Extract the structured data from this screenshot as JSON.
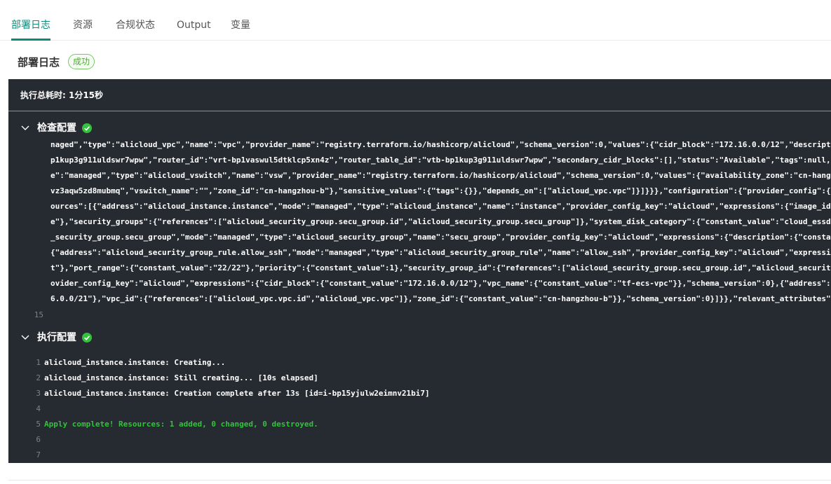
{
  "tabs": [
    {
      "label": "部署日志",
      "active": true
    },
    {
      "label": "资源"
    },
    {
      "label": "合规状态"
    },
    {
      "label": "Output"
    },
    {
      "label": "变量"
    }
  ],
  "header": {
    "title": "部署日志",
    "status": "成功"
  },
  "log": {
    "duration": "执行总耗时: 1分15秒",
    "groups": [
      {
        "title": "检查配置",
        "status_icon": "check-circle-icon",
        "lines": [
          "naged\",\"type\":\"alicloud_vpc\",\"name\":\"vpc\",\"provider_name\":\"registry.terraform.io/hashicorp/alicloud\",\"schema_version\":0,\"values\":{\"cidr_block\":\"172.16.0.0/12\",\"descripti",
          "p1kup3g911uldswr7wpw\",\"router_id\":\"vrt-bp1vaswul5dtklcp5xn4z\",\"router_table_id\":\"vtb-bp1kup3g911uldswr7wpw\",\"secondary_cidr_blocks\":[],\"status\":\"Available\",\"tags\":null,\"",
          "e\":\"managed\",\"type\":\"alicloud_vswitch\",\"name\":\"vsw\",\"provider_name\":\"registry.terraform.io/hashicorp/alicloud\",\"schema_version\":0,\"values\":{\"availability_zone\":\"cn-hangz",
          "vz3aqw5zd8mubmq\",\"vswitch_name\":\"\",\"zone_id\":\"cn-hangzhou-b\"},\"sensitive_values\":{\"tags\":{}},\"depends_on\":[\"alicloud_vpc.vpc\"]}]}}},\"configuration\":{\"provider_config\":{\"",
          "ources\":[{\"address\":\"alicloud_instance.instance\",\"mode\":\"managed\",\"type\":\"alicloud_instance\",\"name\":\"instance\",\"provider_config_key\":\"alicloud\",\"expressions\":{\"image_id\"",
          "e\"},\"security_groups\":{\"references\":[\"alicloud_security_group.secu_group.id\",\"alicloud_security_group.secu_group\"]},\"system_disk_category\":{\"constant_value\":\"cloud_essd\"",
          "_security_group.secu_group\",\"mode\":\"managed\",\"type\":\"alicloud_security_group\",\"name\":\"secu_group\",\"provider_config_key\":\"alicloud\",\"expressions\":{\"description\":{\"constan",
          "{\"address\":\"alicloud_security_group_rule.allow_ssh\",\"mode\":\"managed\",\"type\":\"alicloud_security_group_rule\",\"name\":\"allow_ssh\",\"provider_config_key\":\"alicloud\",\"expressio",
          "t\"},\"port_range\":{\"constant_value\":\"22/22\"},\"priority\":{\"constant_value\":1},\"security_group_id\":{\"references\":[\"alicloud_security_group.secu_group.id\",\"alicloud_security",
          "ovider_config_key\":\"alicloud\",\"expressions\":{\"cidr_block\":{\"constant_value\":\"172.16.0.0/12\"},\"vpc_name\":{\"constant_value\":\"tf-ecs-vpc\"}},\"schema_version\":0},{\"address\":\"",
          "6.0.0/21\"},\"vpc_id\":{\"references\":[\"alicloud_vpc.vpc.id\",\"alicloud_vpc.vpc\"]},\"zone_id\":{\"constant_value\":\"cn-hangzhou-b\"}},\"schema_version\":0}]}},\"relevant_attributes\":"
        ],
        "trailing_line_number": "15"
      },
      {
        "title": "执行配置",
        "status_icon": "check-circle-icon",
        "numbered_lines": [
          {
            "n": "1",
            "text": "alicloud_instance.instance: Creating..."
          },
          {
            "n": "2",
            "text": "alicloud_instance.instance: Still creating... [10s elapsed]"
          },
          {
            "n": "3",
            "text": "alicloud_instance.instance: Creation complete after 13s [id=i-bp15yjulw2eimnv21bi7]"
          },
          {
            "n": "4",
            "text": ""
          },
          {
            "n": "5",
            "text": "Apply complete! Resources: 1 added, 0 changed, 0 destroyed.",
            "color": "#35c03d"
          },
          {
            "n": "6",
            "text": ""
          },
          {
            "n": "7",
            "text": ""
          }
        ]
      }
    ]
  },
  "colors": {
    "accent": "#0f8a78",
    "panel_bg": "#262b31",
    "success": "#35c03d"
  }
}
